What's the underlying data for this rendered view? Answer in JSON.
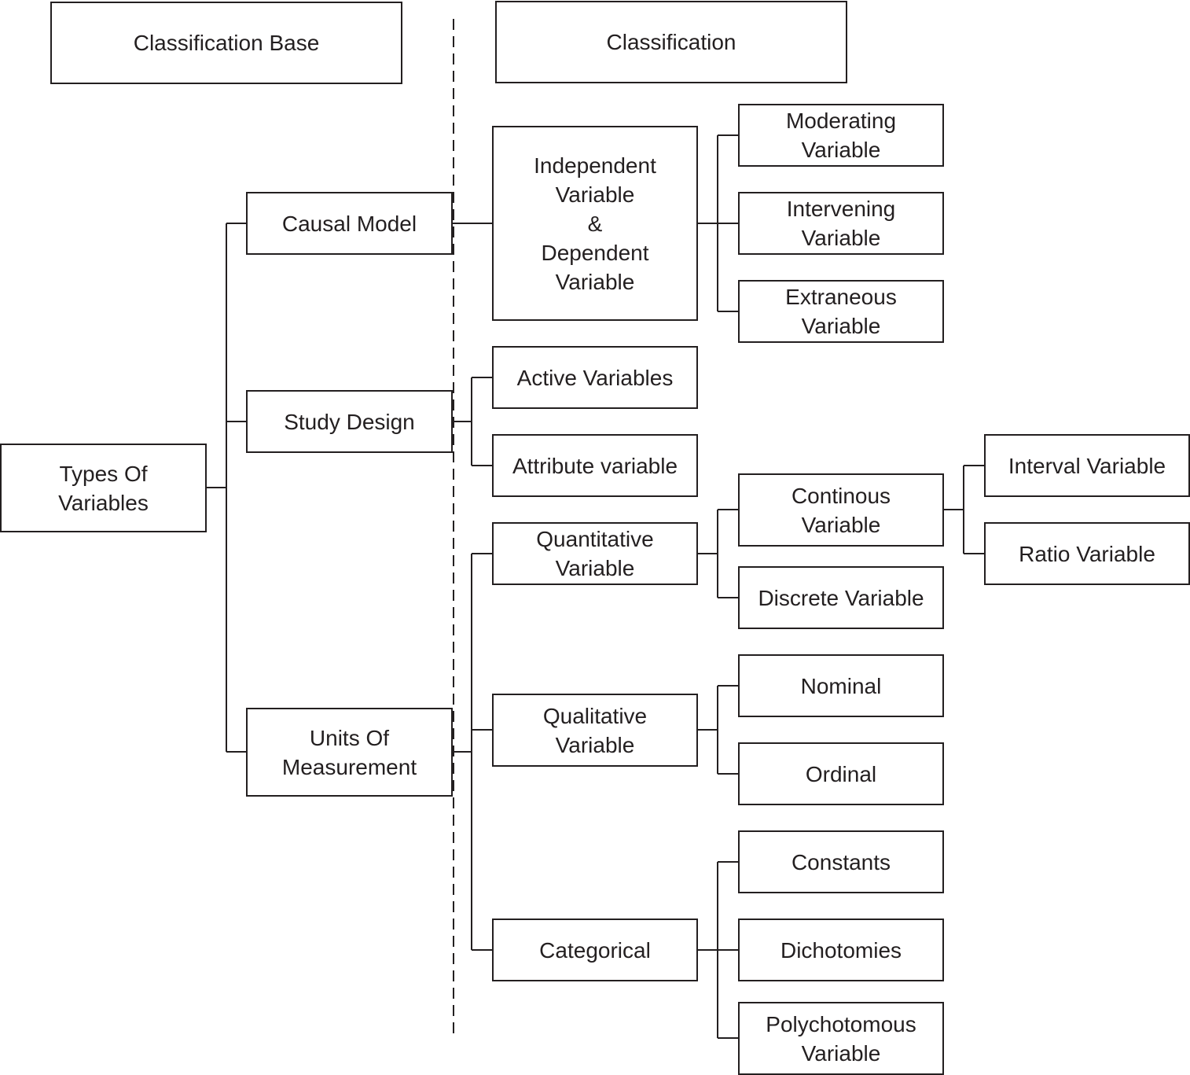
{
  "headers": {
    "classification_base": "Classification Base",
    "classification": "Classification"
  },
  "nodes": {
    "root": "Types Of\nVariables",
    "causal_model": "Causal Model",
    "study_design": "Study Design",
    "units_of_measurement": "Units Of\nMeasurement",
    "independent_dependent": "Independent\nVariable\n&\nDependent\nVariable",
    "moderating": "Moderating\nVariable",
    "intervening": "Intervening\nVariable",
    "extraneous": "Extraneous\nVariable",
    "active": "Active Variables",
    "attribute": "Attribute variable",
    "quantitative": "Quantitative\nVariable",
    "continuous": "Continous\nVariable",
    "discrete": "Discrete Variable",
    "interval": "Interval Variable",
    "ratio": "Ratio Variable",
    "qualitative": "Qualitative\nVariable",
    "nominal": "Nominal",
    "ordinal": "Ordinal",
    "categorical": "Categorical",
    "constants": "Constants",
    "dichotomies": "Dichotomies",
    "polychotomous": "Polychotomous\nVariable"
  }
}
